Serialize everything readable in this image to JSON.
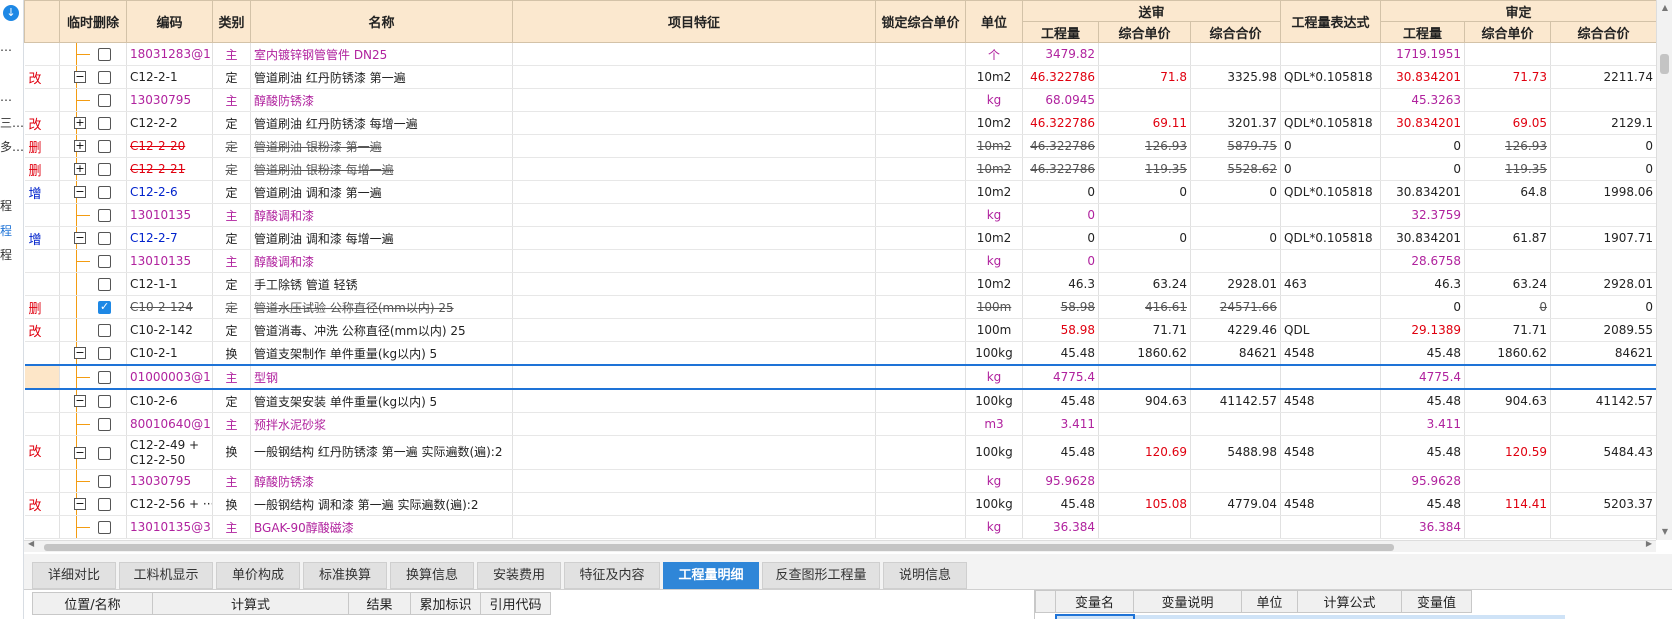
{
  "left_strip": {
    "items": [
      "…",
      "…",
      "三…",
      "多…",
      "程",
      "程",
      "程"
    ]
  },
  "columns": {
    "temp_delete": "临时删除",
    "code": "编码",
    "category": "类别",
    "name": "名称",
    "feature": "项目特征",
    "locked_price": "锁定综合单价",
    "unit": "单位",
    "submit_group": "送审",
    "review_group": "审定",
    "quantity": "工程量",
    "unit_price": "综合单价",
    "total_price": "综合合价",
    "expr": "工程量表达式"
  },
  "rows": [
    {
      "flag": "",
      "tree": "leaf",
      "checked": false,
      "code": "18031283@1",
      "cat": "主",
      "name": "室内镀锌钢管管件 DN25",
      "unit": "个",
      "s_qty": "3479.82",
      "s_up": "",
      "s_tp": "",
      "expr": "",
      "r_qty": "1719.1951",
      "r_up": "",
      "r_tp": "",
      "style": "mag",
      "strike": false
    },
    {
      "flag": "改",
      "tree": "minus",
      "checked": false,
      "code": "C12-2-1",
      "cat": "定",
      "name": "管道刷油 红丹防锈漆 第一遍",
      "unit": "10m2",
      "s_qty": "46.322786",
      "s_up": "71.8",
      "s_tp": "3325.98",
      "expr": "QDL*0.105818",
      "r_qty": "30.834201",
      "r_up": "71.73",
      "r_tp": "2211.74",
      "style": "dark",
      "strike": false,
      "red_qty": true,
      "red_up": true
    },
    {
      "flag": "",
      "tree": "leaf",
      "checked": false,
      "code": "13030795",
      "cat": "主",
      "name": "醇酸防锈漆",
      "unit": "kg",
      "s_qty": "68.0945",
      "s_up": "",
      "s_tp": "",
      "expr": "",
      "r_qty": "45.3263",
      "r_up": "",
      "r_tp": "",
      "style": "mag",
      "strike": false
    },
    {
      "flag": "改",
      "tree": "plus",
      "checked": false,
      "code": "C12-2-2",
      "cat": "定",
      "name": "管道刷油 红丹防锈漆 每增一遍",
      "unit": "10m2",
      "s_qty": "46.322786",
      "s_up": "69.11",
      "s_tp": "3201.37",
      "expr": "QDL*0.105818",
      "r_qty": "30.834201",
      "r_up": "69.05",
      "r_tp": "2129.1",
      "style": "dark",
      "strike": false,
      "red_qty": true,
      "red_up": true
    },
    {
      "flag": "删",
      "tree": "plus",
      "checked": false,
      "code": "C12-2-20",
      "cat": "定",
      "name": "管道刷油 银粉漆 第一遍",
      "unit": "10m2",
      "s_qty": "46.322786",
      "s_up": "126.93",
      "s_tp": "5879.75",
      "expr": "0",
      "r_qty": "0",
      "r_up": "126.93",
      "r_tp": "0",
      "style": "dark",
      "strike": true,
      "code_red": true
    },
    {
      "flag": "删",
      "tree": "plus",
      "checked": false,
      "code": "C12-2-21",
      "cat": "定",
      "name": "管道刷油 银粉漆 每增一遍",
      "unit": "10m2",
      "s_qty": "46.322786",
      "s_up": "119.35",
      "s_tp": "5528.62",
      "expr": "0",
      "r_qty": "0",
      "r_up": "119.35",
      "r_tp": "0",
      "style": "dark",
      "strike": true,
      "code_red": true
    },
    {
      "flag": "增",
      "tree": "minus",
      "checked": false,
      "code": "C12-2-6",
      "cat": "定",
      "name": "管道刷油 调和漆 第一遍",
      "unit": "10m2",
      "s_qty": "0",
      "s_up": "0",
      "s_tp": "0",
      "expr": "QDL*0.105818",
      "r_qty": "30.834201",
      "r_up": "64.8",
      "r_tp": "1998.06",
      "style": "dark",
      "strike": false,
      "code_blue": true
    },
    {
      "flag": "",
      "tree": "leaf",
      "checked": false,
      "code": "13010135",
      "cat": "主",
      "name": "醇酸调和漆",
      "unit": "kg",
      "s_qty": "0",
      "s_up": "",
      "s_tp": "",
      "expr": "",
      "r_qty": "32.3759",
      "r_up": "",
      "r_tp": "",
      "style": "mag",
      "strike": false
    },
    {
      "flag": "增",
      "tree": "minus",
      "checked": false,
      "code": "C12-2-7",
      "cat": "定",
      "name": "管道刷油 调和漆 每增一遍",
      "unit": "10m2",
      "s_qty": "0",
      "s_up": "0",
      "s_tp": "0",
      "expr": "QDL*0.105818",
      "r_qty": "30.834201",
      "r_up": "61.87",
      "r_tp": "1907.71",
      "style": "dark",
      "strike": false,
      "code_blue": true
    },
    {
      "flag": "",
      "tree": "leaf",
      "checked": false,
      "code": "13010135",
      "cat": "主",
      "name": "醇酸调和漆",
      "unit": "kg",
      "s_qty": "0",
      "s_up": "",
      "s_tp": "",
      "expr": "",
      "r_qty": "28.6758",
      "r_up": "",
      "r_tp": "",
      "style": "mag",
      "strike": false
    },
    {
      "flag": "",
      "tree": "none",
      "checked": false,
      "code": "C12-1-1",
      "cat": "定",
      "name": "手工除锈 管道 轻锈",
      "unit": "10m2",
      "s_qty": "46.3",
      "s_up": "63.24",
      "s_tp": "2928.01",
      "expr": "463",
      "r_qty": "46.3",
      "r_up": "63.24",
      "r_tp": "2928.01",
      "style": "dark",
      "strike": false
    },
    {
      "flag": "删",
      "tree": "none",
      "checked": true,
      "code": "C10-2-124",
      "cat": "定",
      "name": "管道水压试验 公称直径(mm以内) 25",
      "unit": "100m",
      "s_qty": "58.98",
      "s_up": "416.61",
      "s_tp": "24571.66",
      "expr": "",
      "r_qty": "0",
      "r_up": "0",
      "r_tp": "0",
      "style": "grey",
      "strike": true
    },
    {
      "flag": "改",
      "tree": "none",
      "checked": false,
      "code": "C10-2-142",
      "cat": "定",
      "name": "管道消毒、冲洗 公称直径(mm以内) 25",
      "unit": "100m",
      "s_qty": "58.98",
      "s_up": "71.71",
      "s_tp": "4229.46",
      "expr": "QDL",
      "r_qty": "29.1389",
      "r_up": "71.71",
      "r_tp": "2089.55",
      "style": "dark",
      "strike": false,
      "red_qty": true
    },
    {
      "flag": "",
      "tree": "minus",
      "checked": false,
      "code": "C10-2-1",
      "cat": "换",
      "name": "管道支架制作 单件重量(kg以内) 5",
      "unit": "100kg",
      "s_qty": "45.48",
      "s_up": "1860.62",
      "s_tp": "84621",
      "expr": "4548",
      "r_qty": "45.48",
      "r_up": "1860.62",
      "r_tp": "84621",
      "style": "dark",
      "strike": false
    },
    {
      "flag": "",
      "tree": "leaf",
      "checked": false,
      "code": "01000003@1",
      "cat": "主",
      "name": "型钢",
      "unit": "kg",
      "s_qty": "4775.4",
      "s_up": "",
      "s_tp": "",
      "expr": "",
      "r_qty": "4775.4",
      "r_up": "",
      "r_tp": "",
      "style": "mag",
      "strike": false,
      "selected": true
    },
    {
      "flag": "",
      "tree": "minus",
      "checked": false,
      "code": "C10-2-6",
      "cat": "定",
      "name": "管道支架安装 单件重量(kg以内) 5",
      "unit": "100kg",
      "s_qty": "45.48",
      "s_up": "904.63",
      "s_tp": "41142.57",
      "expr": "4548",
      "r_qty": "45.48",
      "r_up": "904.63",
      "r_tp": "41142.57",
      "style": "dark",
      "strike": false
    },
    {
      "flag": "",
      "tree": "leaf",
      "checked": false,
      "code": "80010640@1",
      "cat": "主",
      "name": "预拌水泥砂浆",
      "unit": "m3",
      "s_qty": "3.411",
      "s_up": "",
      "s_tp": "",
      "expr": "",
      "r_qty": "3.411",
      "r_up": "",
      "r_tp": "",
      "style": "mag",
      "strike": false
    },
    {
      "flag": "改",
      "tree": "minus",
      "checked": false,
      "code": "C12-2-49 + C12-2-50",
      "cat": "换",
      "name": "一般钢结构 红丹防锈漆 第一遍  实际遍数(遍):2",
      "unit": "100kg",
      "s_qty": "45.48",
      "s_up": "120.69",
      "s_tp": "5488.98",
      "expr": "4548",
      "r_qty": "45.48",
      "r_up": "120.59",
      "r_tp": "5484.43",
      "style": "dark",
      "strike": false,
      "tall": true,
      "red_up": true
    },
    {
      "flag": "",
      "tree": "leaf",
      "checked": false,
      "code": "13030795",
      "cat": "主",
      "name": "醇酸防锈漆",
      "unit": "kg",
      "s_qty": "95.9628",
      "s_up": "",
      "s_tp": "",
      "expr": "",
      "r_qty": "95.9628",
      "r_up": "",
      "r_tp": "",
      "style": "mag",
      "strike": false
    },
    {
      "flag": "改",
      "tree": "minus",
      "checked": false,
      "code": "C12-2-56 + ···",
      "cat": "换",
      "name": "一般钢结构 调和漆 第一遍  实际遍数(遍):2",
      "unit": "100kg",
      "s_qty": "45.48",
      "s_up": "105.08",
      "s_tp": "4779.04",
      "expr": "4548",
      "r_qty": "45.48",
      "r_up": "114.41",
      "r_tp": "5203.37",
      "style": "dark",
      "strike": false,
      "red_up": true
    },
    {
      "flag": "",
      "tree": "leaf",
      "checked": false,
      "code": "13010135@3",
      "cat": "主",
      "name": "BGAK-90醇酸磁漆",
      "unit": "kg",
      "s_qty": "36.384",
      "s_up": "",
      "s_tp": "",
      "expr": "",
      "r_qty": "36.384",
      "r_up": "",
      "r_tp": "",
      "style": "mag",
      "strike": false
    }
  ],
  "tabs": [
    "详细对比",
    "工料机显示",
    "单价构成",
    "标准换算",
    "换算信息",
    "安装费用",
    "特征及内容",
    "工程量明细",
    "反查图形工程量",
    "说明信息"
  ],
  "active_tab": "工程量明细",
  "bottom_left_headers": [
    "位置/名称",
    "计算式",
    "结果",
    "累加标识",
    "引用代码"
  ],
  "bottom_right_headers": [
    "",
    "变量名",
    "变量说明",
    "单位",
    "计算公式",
    "变量值"
  ],
  "colors": {
    "header_bg": "#fbe8cf",
    "tree_line": "#f39c12",
    "accent": "#2f86d8",
    "changed": "#e0000f",
    "added": "#0022cc",
    "material": "#b0229e"
  }
}
